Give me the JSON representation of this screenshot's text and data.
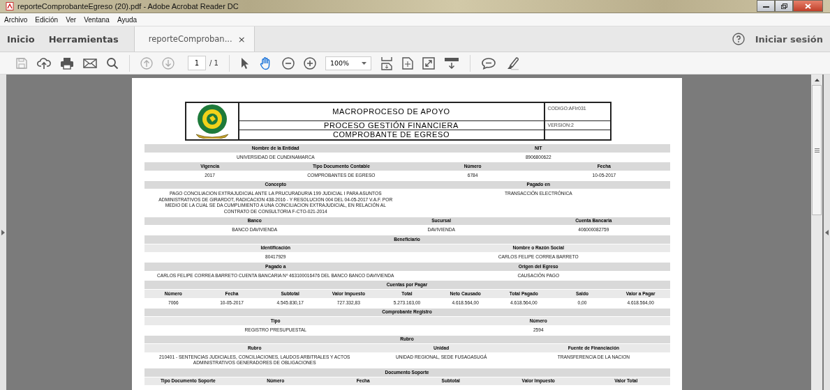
{
  "window": {
    "title": "reporteComprobanteEgreso (20).pdf - Adobe Acrobat Reader DC"
  },
  "menu": [
    "Archivo",
    "Edición",
    "Ver",
    "Ventana",
    "Ayuda"
  ],
  "nav": [
    {
      "label": "Inicio",
      "selected": false
    },
    {
      "label": "Herramientas",
      "selected": false
    }
  ],
  "document_tab": {
    "label": "reporteComproban...",
    "close": "×",
    "selected": true
  },
  "account": {
    "label": "Iniciar sesión"
  },
  "toolbar": {
    "page": "1",
    "page_total": "/ 1",
    "zoom": "100%"
  },
  "document": {
    "header": {
      "titles": [
        "MACROPROCESO DE APOYO",
        "PROCESO GESTIÓN FINANCIERA",
        "COMPROBANTE DE EGRESO"
      ],
      "codes": [
        "CODIGO:AFIr031",
        "VERSION:2"
      ]
    },
    "rows": [
      {
        "kind": "band",
        "cells": [
          "Nombre de la Entidad",
          "NIT"
        ]
      },
      {
        "kind": "values",
        "cells": [
          "UNIVERSIDAD DE CUNDINAMARCA",
          "8906800622"
        ]
      },
      {
        "kind": "band",
        "cells": [
          "Vigencia",
          "Tipo Documento Contable",
          "Número",
          "Fecha"
        ]
      },
      {
        "kind": "values",
        "cells": [
          "2017",
          "COMPROBANTES DE EGRESO",
          "6784",
          "10-05-2017"
        ]
      },
      {
        "kind": "band",
        "cells": [
          "Concepto",
          "Pagado en"
        ]
      },
      {
        "kind": "values",
        "cells": [
          "PAGO CONCILIACION EXTRAJUDICIAL ANTE LA PRUCURADURIA 199 JUDICIAL I PARA ASUNTOS ADMINISTRATIVOS DE GIRARDOT, RADICACION 438-2016 - Y RESOLUCION 004 DEL 04-05-2017 V.A.F. POR MEDIO DE LA CUAL SE DA CUMPLIMIENTO A UNA CONCILIACION EXTRAJUDICIAL, EN RELACIÓN AL CONTRATO DE CONSULTORIA F-CTO-021-2014",
          "TRANSACCIÓN ELECTRÓNICA"
        ]
      },
      {
        "kind": "band",
        "cells": [
          "Banco",
          "Sucursal",
          "Cuenta Bancaria"
        ]
      },
      {
        "kind": "values",
        "cells": [
          "BANCO DAVIVIENDA",
          "DAVIVIENDA",
          "406000082759"
        ]
      },
      {
        "kind": "band",
        "cells": [
          "Beneficiario"
        ]
      },
      {
        "kind": "header",
        "cells": [
          "Identificación",
          "Nombre o Razón Social"
        ]
      },
      {
        "kind": "values",
        "cells": [
          "80417929",
          "CARLOS FELIPE CORREA BARRETO"
        ]
      },
      {
        "kind": "band",
        "cells": [
          "Pagado a",
          "Origen del Egreso"
        ]
      },
      {
        "kind": "values",
        "cells": [
          "CARLOS FELIPE CORREA BARRETO CUENTA BANCARIA Nº 463100016476 DEL BANCO BANCO DAVIVIENDA",
          "CAUSACIÓN PAGO"
        ]
      },
      {
        "kind": "band",
        "cells": [
          "Cuentas por Pagar"
        ]
      },
      {
        "kind": "header",
        "cells": [
          "Número",
          "Fecha",
          "Subtotal",
          "Valor Impuesto",
          "Total",
          "Neto Causado",
          "Total Pagado",
          "Saldo",
          "Valor a Pagar"
        ]
      },
      {
        "kind": "values",
        "cells": [
          "7066",
          "10-05-2017",
          "4.545.830,17",
          "727.332,83",
          "5.273.163,00",
          "4.618.564,00",
          "4.618.564,00",
          "0,00",
          "4.618.564,00"
        ]
      },
      {
        "kind": "band",
        "cells": [
          "Comprobante Registro"
        ]
      },
      {
        "kind": "header",
        "cells": [
          "Tipo",
          "Número"
        ]
      },
      {
        "kind": "values",
        "cells": [
          "REGISTRO PRESUPUESTAL",
          "2594"
        ]
      },
      {
        "kind": "band",
        "cells": [
          "Rubro"
        ]
      },
      {
        "kind": "header",
        "cells": [
          "Rubro",
          "Unidad",
          "Fuente de Financiación"
        ]
      },
      {
        "kind": "values",
        "cells": [
          "210401 - SENTENCIAS JUDICIALES, CONCILIACIONES, LAUDOS ARBITRALES Y ACTOS ADMINISTRATIVOS GENERADORES DE OBLIGACIONES",
          "UNIDAD REGIONAL, SEDE FUSAGASUGÁ",
          "TRANSFERENCIA DE LA NACION"
        ]
      },
      {
        "kind": "band",
        "cells": [
          "Documento Soporte"
        ]
      },
      {
        "kind": "header",
        "cells": [
          "Tipo Documento Soporte",
          "Número",
          "Fecha",
          "Subtotal",
          "Valor Impuesto",
          "Valor Total"
        ]
      }
    ]
  }
}
